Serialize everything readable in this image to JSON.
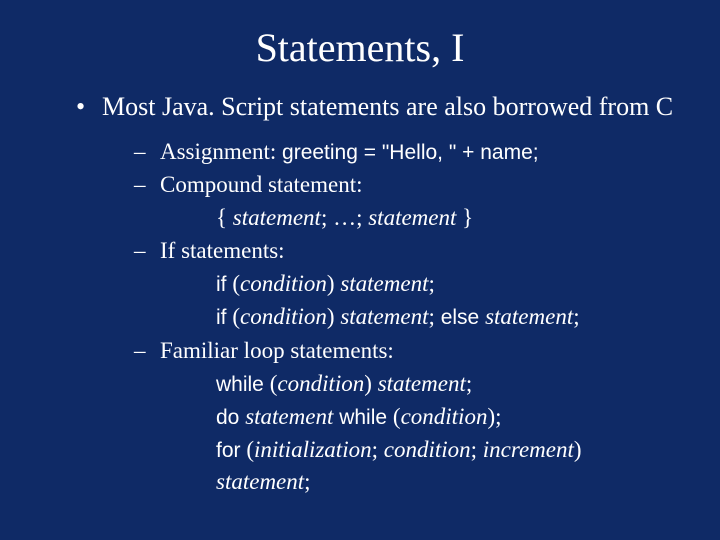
{
  "title": "Statements, I",
  "bullet1": "Most Java. Script statements are also borrowed from C",
  "assign_label": "Assignment: ",
  "assign_code": "greeting = \"Hello, \" + name;",
  "compound_label": "Compound statement:",
  "compound_open": "{ ",
  "compound_stmt": "statement",
  "compound_semi": "; ",
  "compound_dots": "…",
  "compound_sep2": "; ",
  "compound_close": " }",
  "if_label": "If statements:",
  "kw_if": "if ",
  "kw_else": " else ",
  "paren_open": "(",
  "paren_close": ") ",
  "cond": "condition",
  "stmt": "statement",
  "semi": ";",
  "loop_label": "Familiar loop statements:",
  "kw_while": "while ",
  "kw_do": "do ",
  "kw_while2": " while ",
  "kw_for": "for ",
  "init": "initialization",
  "inc": "increment",
  "paren_close_semi": ");",
  "sep_semi_sp": "; "
}
